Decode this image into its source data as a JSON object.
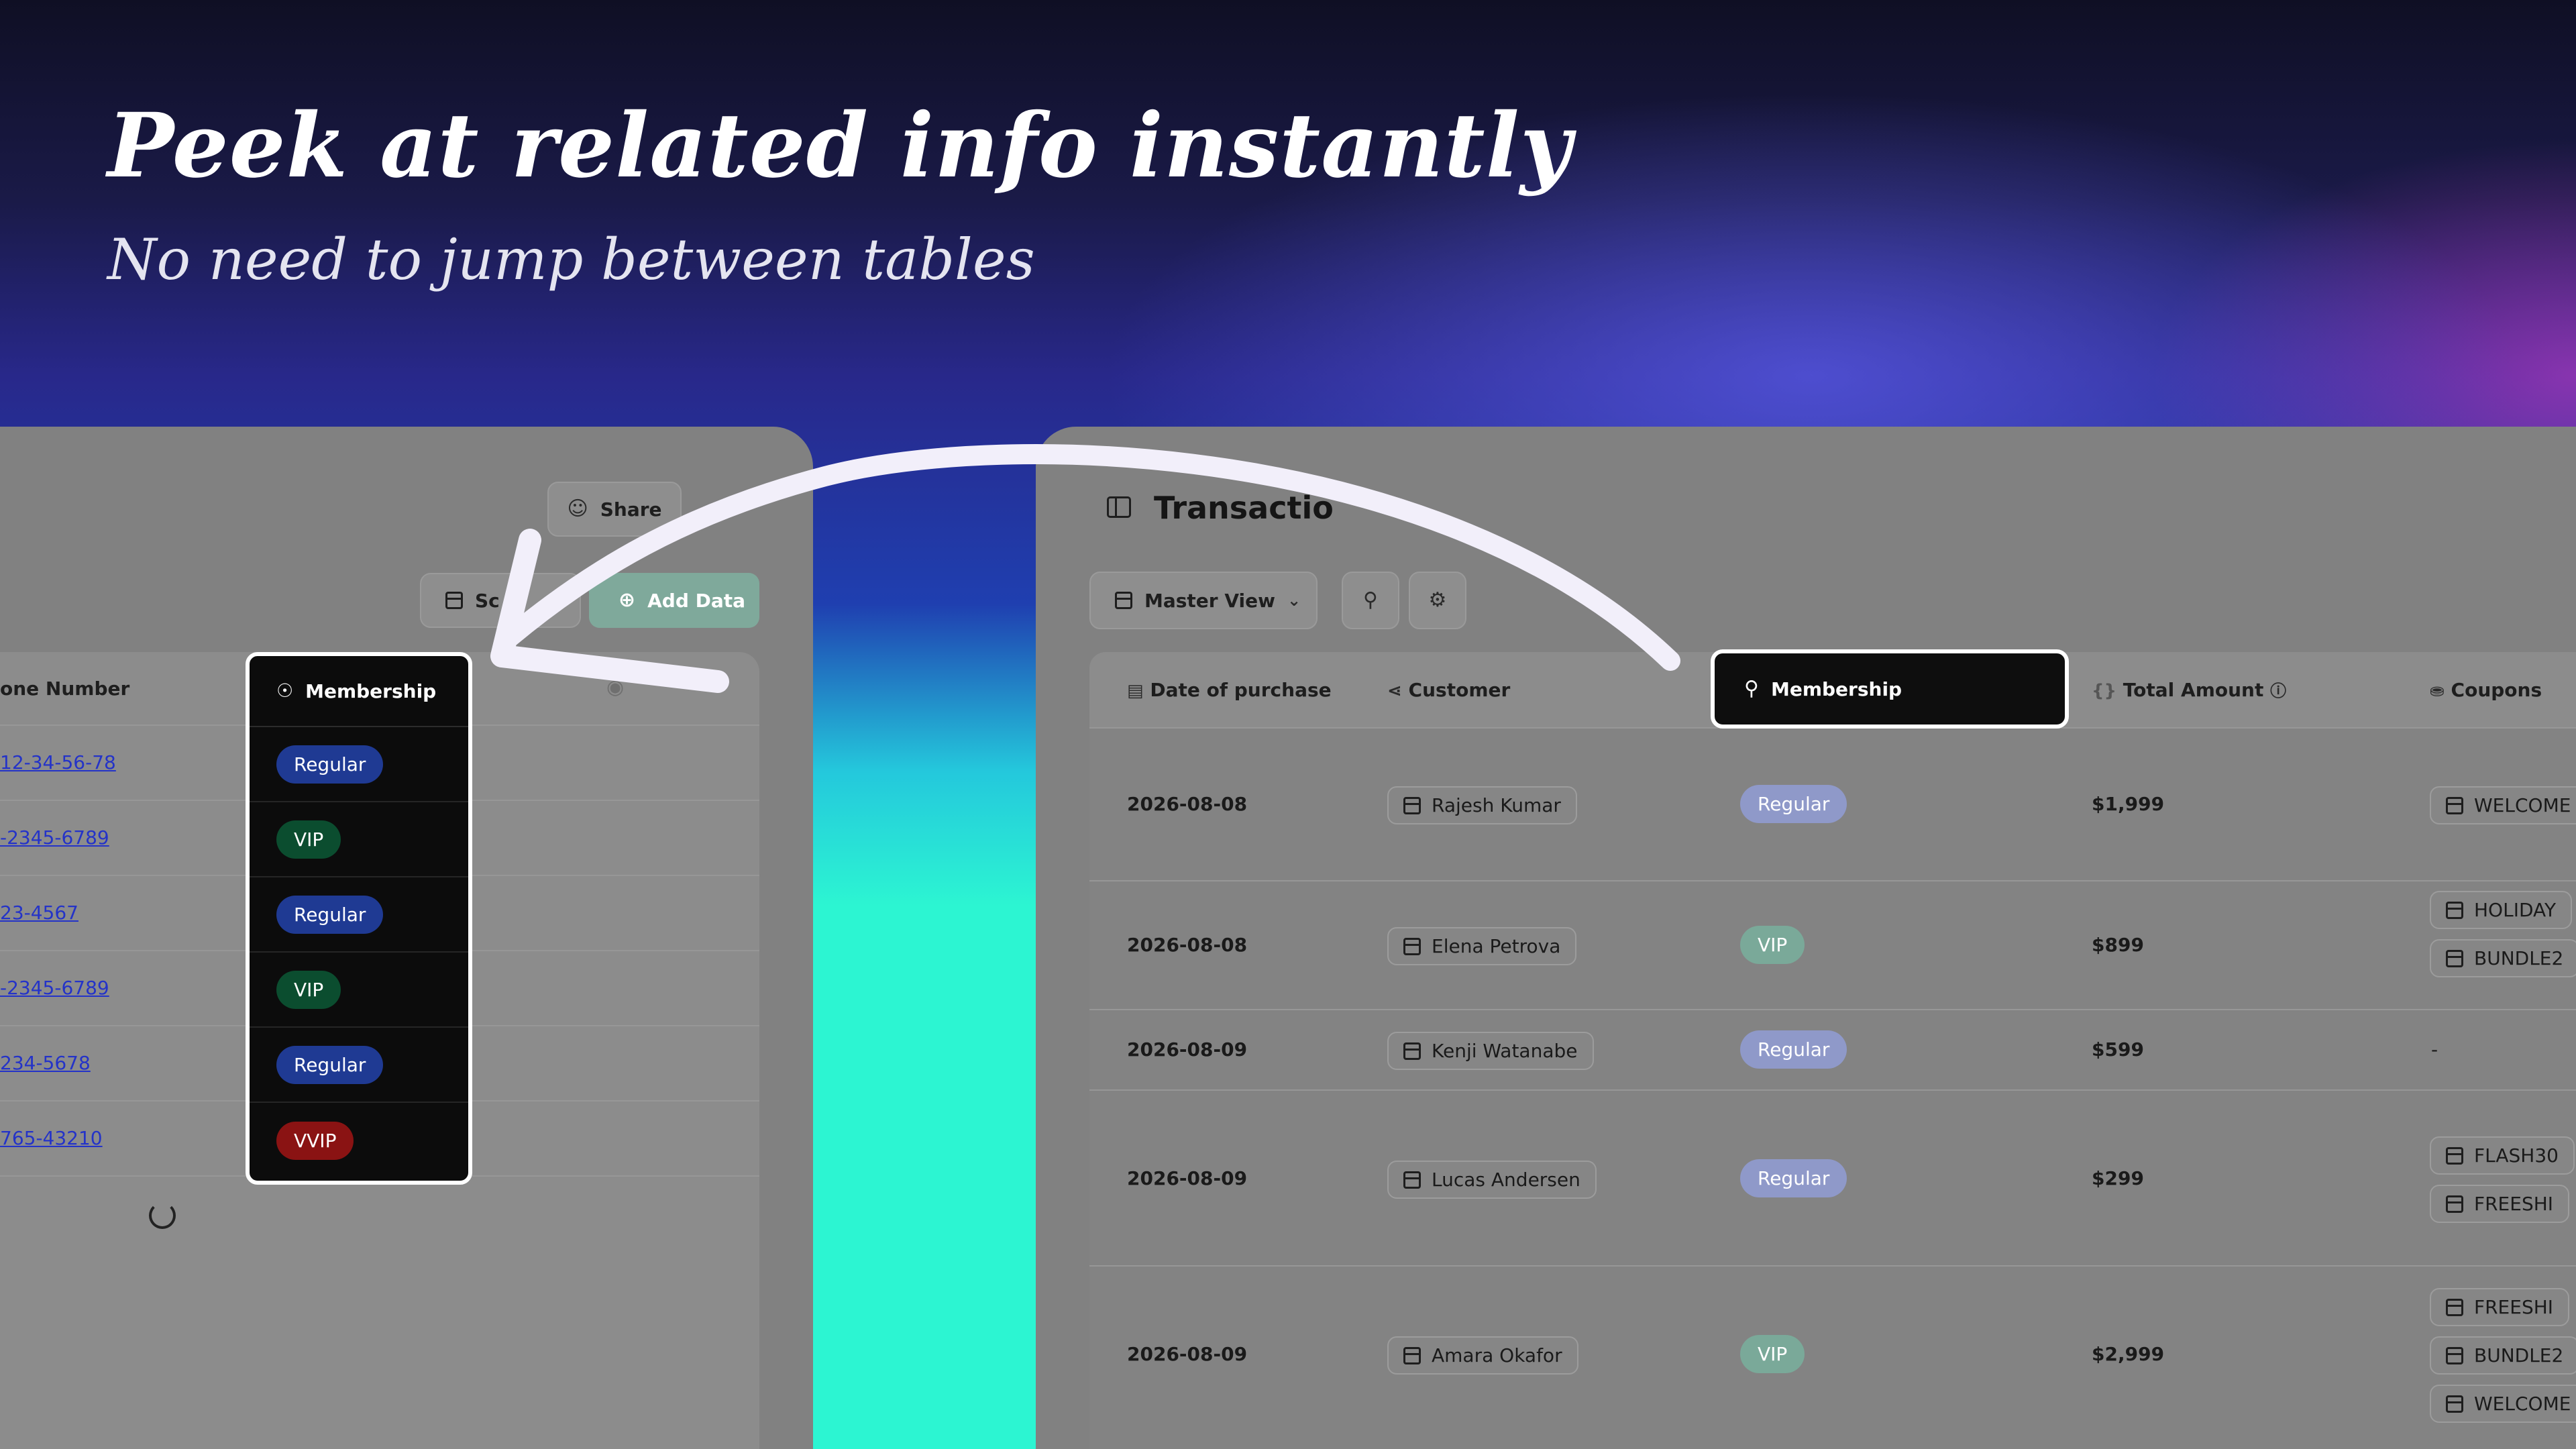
{
  "hero": {
    "title": "Peek at related info instantly",
    "subtitle": "No need to jump between tables"
  },
  "left_panel": {
    "share_label": "Share",
    "more_icon": "ellipsis-icon",
    "schema_label": "Sc",
    "add_data_label": "Add Data",
    "phone_header": "one Number",
    "phones": [
      "12-34-56-78",
      "-2345-6789",
      "23-4567",
      "-2345-6789",
      "234-5678",
      "765-43210"
    ]
  },
  "dropdown": {
    "header": "Membership",
    "options": [
      {
        "label": "Regular",
        "color": "#1f3a93"
      },
      {
        "label": "VIP",
        "color": "#0b4d2f"
      },
      {
        "label": "Regular",
        "color": "#1f3a93"
      },
      {
        "label": "VIP",
        "color": "#0b4d2f"
      },
      {
        "label": "Regular",
        "color": "#1f3a93"
      },
      {
        "label": "VVIP",
        "color": "#8a1313"
      }
    ]
  },
  "right_panel": {
    "title": "Transactio",
    "view_label": "Master View",
    "columns": {
      "date": "Date of purchase",
      "customer": "Customer",
      "membership": "Membership",
      "total": "Total Amount",
      "coupons": "Coupons"
    },
    "rows": [
      {
        "date": "2026-08-08",
        "customer": "Rajesh Kumar",
        "membership": "Regular",
        "total": "$1,999",
        "coupons": [
          "WELCOME"
        ]
      },
      {
        "date": "2026-08-08",
        "customer": "Elena Petrova",
        "membership": "VIP",
        "total": "$899",
        "coupons": [
          "HOLIDAY",
          "BUNDLE2"
        ]
      },
      {
        "date": "2026-08-09",
        "customer": "Kenji Watanabe",
        "membership": "Regular",
        "total": "$599",
        "coupons": [
          "-"
        ]
      },
      {
        "date": "2026-08-09",
        "customer": "Lucas Andersen",
        "membership": "Regular",
        "total": "$299",
        "coupons": [
          "FLASH30",
          "FREESHI"
        ]
      },
      {
        "date": "2026-08-09",
        "customer": "Amara Okafor",
        "membership": "VIP",
        "total": "$2,999",
        "coupons": [
          "FREESHI",
          "BUNDLE2",
          "WELCOME"
        ]
      }
    ]
  },
  "colors": {
    "regular_pill": "#8f99c9",
    "vip_pill": "#7aa999"
  }
}
